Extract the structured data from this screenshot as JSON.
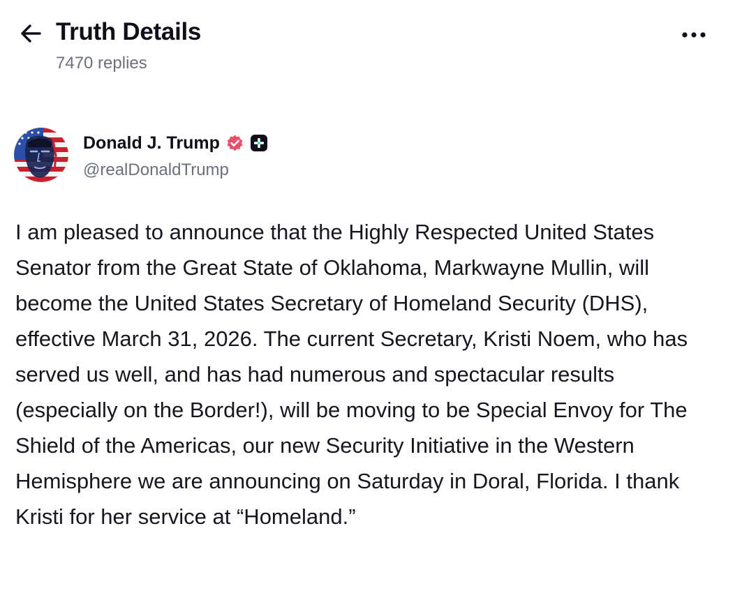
{
  "header": {
    "title": "Truth Details",
    "reply_count": "7470 replies",
    "back_icon": "arrow-left-icon",
    "more_icon": "more-horizontal-icon"
  },
  "post": {
    "author": {
      "name": "Donald J. Trump",
      "handle": "@realDonaldTrump",
      "verified_icon": "verified-badge-icon",
      "plus_icon": "plus-badge-icon"
    },
    "body": "I am pleased to announce that the Highly Respected United States Senator from the Great State of Oklahoma, Markwayne Mullin, will become the United States Secretary of Homeland Security (DHS), effective March 31, 2026. The current Secretary, Kristi Noem, who has served us well, and has had numerous and spectacular results (especially on the Border!), will be moving to be Special Envoy for The Shield of the Americas, our new Security Initiative in the Western Hemisphere we are announcing on Saturday in Doral, Florida. I thank Kristi for her service at “Homeland.”"
  },
  "colors": {
    "text_primary": "#0f0f1a",
    "text_secondary": "#6b6f7e",
    "verified_badge": "#e8506a",
    "plus_badge": "#0f0f1a",
    "plus_badge_accent": "#2ee6c2"
  }
}
